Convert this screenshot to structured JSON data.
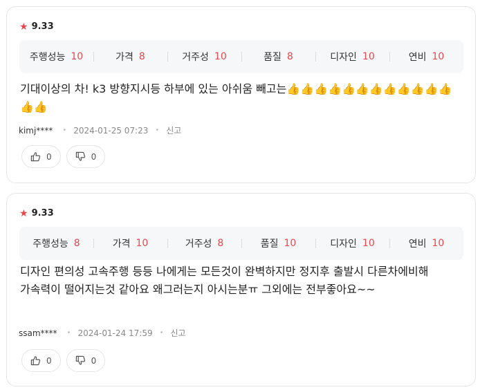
{
  "reviews": [
    {
      "rating": {
        "star_icon": "star-icon",
        "score": "9.33"
      },
      "metrics": [
        {
          "label": "주행성능",
          "value": "10"
        },
        {
          "label": "가격",
          "value": "8"
        },
        {
          "label": "거주성",
          "value": "10"
        },
        {
          "label": "품질",
          "value": "8"
        },
        {
          "label": "디자인",
          "value": "10"
        },
        {
          "label": "연비",
          "value": "10"
        }
      ],
      "text": "기대이상의 차! k3 방향지시등 하부에 있는 아쉬움 빼고는👍👍👍👍👍👍👍👍👍👍👍👍👍👍",
      "user": "kimj****",
      "date": "2024-01-25 07:23",
      "report_label": "신고",
      "likes": "0",
      "dislikes": "0"
    },
    {
      "rating": {
        "star_icon": "star-icon",
        "score": "9.33"
      },
      "metrics": [
        {
          "label": "주행성능",
          "value": "8"
        },
        {
          "label": "가격",
          "value": "10"
        },
        {
          "label": "거주성",
          "value": "8"
        },
        {
          "label": "품질",
          "value": "10"
        },
        {
          "label": "디자인",
          "value": "10"
        },
        {
          "label": "연비",
          "value": "10"
        }
      ],
      "text": "디자인 편의성 고속주행 등등 나에게는 모든것이 완벽하지만 정지후 출발시 다른차에비해 가속력이 떨어지는것 같아요 왜그러는지 아시는분ㅠ 그외에는 전부좋아요~~",
      "user": "ssam****",
      "date": "2024-01-24 17:59",
      "report_label": "신고",
      "likes": "0",
      "dislikes": "0"
    }
  ],
  "colors": {
    "accent": "#e8474c",
    "border": "#e3e5e8",
    "metrics_bg": "#f6f7f9"
  }
}
